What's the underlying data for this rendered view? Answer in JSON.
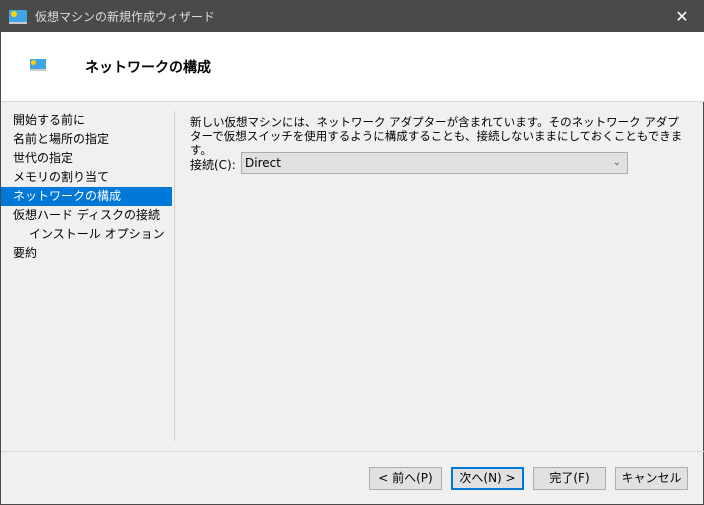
{
  "window": {
    "title": "仮想マシンの新規作成ウィザード",
    "close": "✕"
  },
  "header": {
    "title": "ネットワークの構成"
  },
  "nav": {
    "items": [
      {
        "label": "開始する前に"
      },
      {
        "label": "名前と場所の指定"
      },
      {
        "label": "世代の指定"
      },
      {
        "label": "メモリの割り当て"
      },
      {
        "label": "ネットワークの構成",
        "selected": true
      },
      {
        "label": "仮想ハード ディスクの接続"
      },
      {
        "label": "インストール オプション"
      },
      {
        "label": "要約"
      }
    ]
  },
  "main": {
    "description": "新しい仮想マシンには、ネットワーク アダプターが含まれています。そのネットワーク アダプターで仮想スイッチを使用するように構成することも、接続しないままにしておくこともできます。",
    "connection_label": "接続(C):",
    "connection_value": "Direct"
  },
  "buttons": {
    "prev": "< 前へ(P)",
    "next": "次へ(N) >",
    "finish": "完了(F)",
    "cancel": "キャンセル"
  }
}
